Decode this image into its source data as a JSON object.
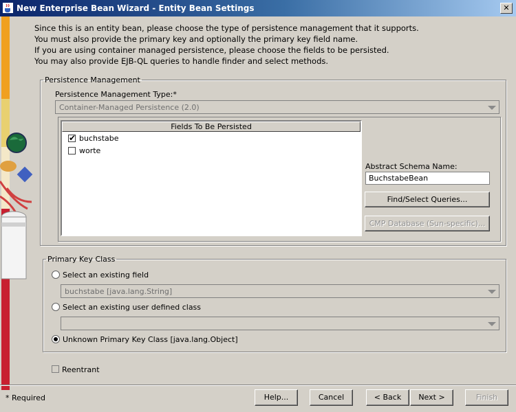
{
  "window": {
    "title": "New Enterprise Bean Wizard - Entity Bean Settings",
    "close_glyph": "✕"
  },
  "intro": [
    "Since this is an entity bean, please choose the type of persistence management that it supports.",
    "You must also provide the primary key and optionally the primary key field name.",
    "If you are using container managed persistence, please choose the fields to be persisted.",
    "You may also provide EJB-QL queries to handle finder and select methods."
  ],
  "persistence": {
    "group_label": "Persistence Management",
    "type_label": "Persistence Management Type:*",
    "type_value": "Container-Managed Persistence (2.0)",
    "fields_header": "Fields To Be Persisted",
    "fields": [
      {
        "name": "buchstabe",
        "checked": true
      },
      {
        "name": "worte",
        "checked": false
      }
    ],
    "schema_label": "Abstract Schema Name:",
    "schema_value": "BuchstabeBean",
    "queries_button": "Find/Select Queries...",
    "cmp_button": "CMP Database (Sun-specific)..."
  },
  "primary_key": {
    "group_label": "Primary Key Class",
    "option_existing_field": "Select an existing field",
    "existing_field_value": "buchstabe  [java.lang.String]",
    "option_user_class": "Select an existing user defined class",
    "user_class_value": "",
    "option_unknown": "Unknown Primary Key Class [java.lang.Object]",
    "selected": "unknown"
  },
  "reentrant_label": "Reentrant",
  "footer": {
    "required_note": "* Required",
    "help": "Help...",
    "cancel": "Cancel",
    "back": "< Back",
    "next": "Next >",
    "finish": "Finish"
  }
}
